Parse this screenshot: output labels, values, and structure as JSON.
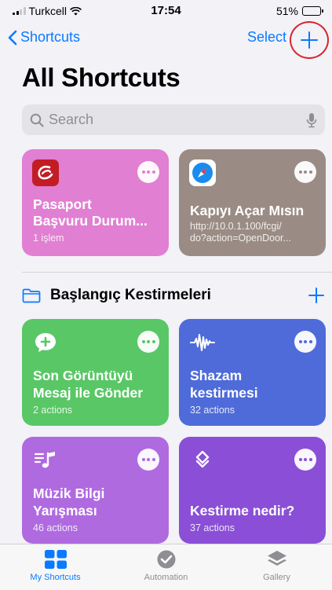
{
  "status": {
    "carrier": "Turkcell",
    "time": "17:54",
    "battery": "51%",
    "battery_level": 0.51
  },
  "nav": {
    "back_label": "Shortcuts",
    "select_label": "Select"
  },
  "page": {
    "title": "All Shortcuts"
  },
  "search": {
    "placeholder": "Search"
  },
  "shortcuts": [
    {
      "title_line1": "Pasaport",
      "title_line2": "Başvuru Durum...",
      "subtitle": "1 işlem",
      "color": "#e17fd2"
    },
    {
      "title_line1": "Kapıyı Açar Mısın",
      "subtitle_line1": "http://10.0.1.100/fcgi/",
      "subtitle_line2": "do?action=OpenDoor...",
      "color": "#9a8c84"
    }
  ],
  "section": {
    "label": "Başlangıç Kestirmeleri"
  },
  "starter": [
    {
      "title_line1": "Son Görüntüyü",
      "title_line2": "Mesaj ile Gönder",
      "subtitle": "2 actions",
      "color": "#59c766"
    },
    {
      "title_line1": "Shazam",
      "title_line2": "kestirmesi",
      "subtitle": "32 actions",
      "color": "#4f6bd9"
    },
    {
      "title_line1": "Müzik Bilgi",
      "title_line2": "Yarışması",
      "subtitle": "46 actions",
      "color": "#b06ae0"
    },
    {
      "title_line1": "Kestirme nedir?",
      "subtitle": "37 actions",
      "color": "#8a4fd6"
    }
  ],
  "tabs": [
    {
      "label": "My Shortcuts",
      "icon": "grid-icon",
      "active": true
    },
    {
      "label": "Automation",
      "icon": "automation-check-icon",
      "active": false
    },
    {
      "label": "Gallery",
      "icon": "layers-icon",
      "active": false
    }
  ],
  "colors": {
    "accent": "#0a7aff",
    "highlight_circle": "#d5262c"
  }
}
